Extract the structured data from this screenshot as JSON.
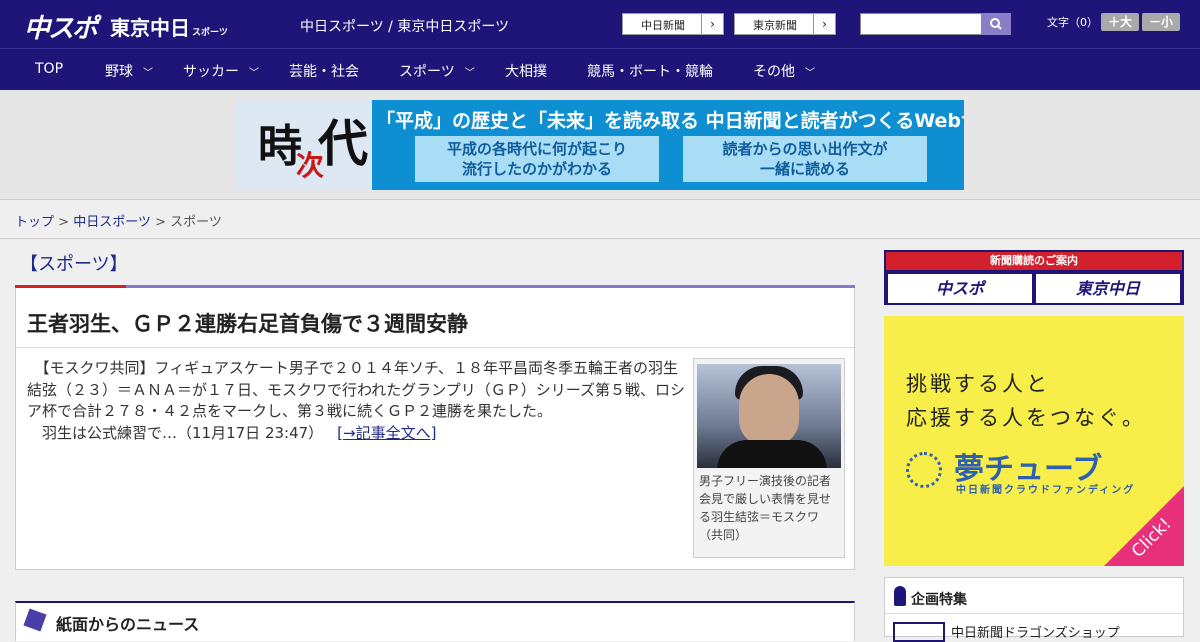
{
  "header": {
    "logo_chuspo": "中スポ",
    "logo_tokyo": "東京中日",
    "logo_tokyo_small": "スポーツ",
    "site_title": "中日スポーツ / 東京中日スポーツ",
    "links": [
      {
        "label": "中日新聞",
        "arrow": "›"
      },
      {
        "label": "東京新聞",
        "arrow": "›"
      }
    ],
    "search": {
      "placeholder": ""
    },
    "font_size_label": "文字（0）",
    "font_plus": "＋大",
    "font_minus": "－小"
  },
  "nav": [
    {
      "label": "TOP",
      "has_dropdown": false
    },
    {
      "label": "野球",
      "has_dropdown": true
    },
    {
      "label": "サッカー",
      "has_dropdown": true
    },
    {
      "label": "芸能・社会",
      "has_dropdown": false
    },
    {
      "label": "スポーツ",
      "has_dropdown": true
    },
    {
      "label": "大相撲",
      "has_dropdown": false
    },
    {
      "label": "競馬・ボート・競輪",
      "has_dropdown": false
    },
    {
      "label": "その他",
      "has_dropdown": true
    }
  ],
  "banner": {
    "kanji_1": "時",
    "kanji_2": "次",
    "kanji_3": "代",
    "headline": "「平成」の歴史と「未来」を読み取る 中日新聞と読者がつくるWebサイト",
    "sub1_line1": "平成の各時代に何が起こり",
    "sub1_line2": "流行したのかがわかる",
    "sub2_line1": "読者からの思い出作文が",
    "sub2_line2": "一緒に読める"
  },
  "breadcrumb": {
    "home": "トップ",
    "sep1": " > ",
    "parent": "中日スポーツ",
    "sep2": " > ",
    "current": "スポーツ"
  },
  "main": {
    "section_title": "【スポーツ】",
    "article": {
      "title": "王者羽生、ＧＰ２連勝右足首負傷で３週間安静",
      "body": "　【モスクワ共同】フィギュアスケート男子で２０１４年ソチ、１８年平昌両冬季五輪王者の羽生結弦（２３）＝ＡＮＡ＝が１７日、モスクワで行われたグランプリ（ＧＰ）シリーズ第５戦、ロシア杯で合計２７８・４２点をマークし、第３戦に続くＧＰ２連勝を果たした。",
      "body2": "　羽生は公式練習で…（11月17日 23:47）",
      "more_link": "[→記事全文へ]",
      "photo_caption": "男子フリー演技後の記者会見で厳しい表情を見せる羽生結弦＝モスクワ（共同）"
    },
    "news_section_title": "紙面からのニュース"
  },
  "sidebar": {
    "subscribe_title": "新聞購読のご案内",
    "subscribe_a": "中スポ",
    "subscribe_b": "東京中日",
    "ad_line1": "挑戦する人と",
    "ad_line2": "応援する人をつなぐ。",
    "ad_brand": "夢チューブ",
    "ad_brand_sub": "中日新聞クラウドファンディング",
    "ad_click": "Click!",
    "kikaku_title": "企画特集",
    "kikaku_item": "中日新聞ドラゴンズショップ"
  }
}
